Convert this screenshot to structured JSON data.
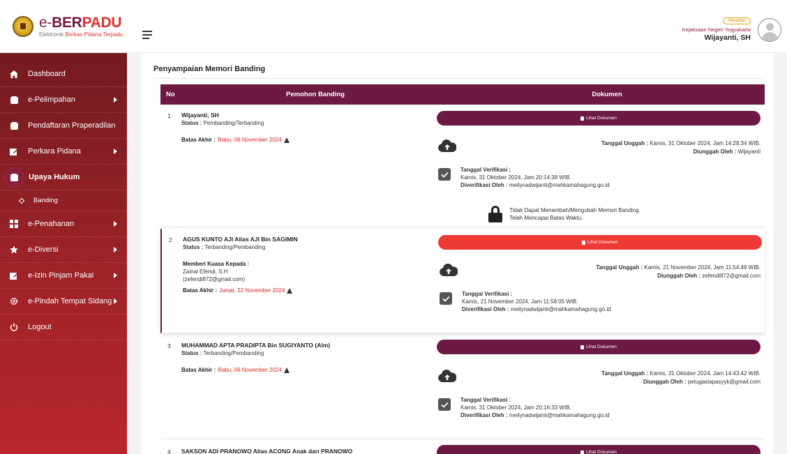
{
  "brand": {
    "title_part1": "e-",
    "title_part2": "BER",
    "title_part3": "PADU",
    "subtitle_a": "Elektronik",
    "subtitle_b": "Berkas Pidana Terpadu"
  },
  "sidebar": {
    "items": [
      {
        "label": "Dashboard",
        "icon": "home-icon"
      },
      {
        "label": "e-Pelimpahan",
        "icon": "folder-icon"
      },
      {
        "label": "Pendaftaran Praperadilan",
        "icon": "folder-icon"
      },
      {
        "label": "Perkara Pidana",
        "icon": "pencil-square-icon"
      },
      {
        "label": "Upaya Hukum",
        "icon": "folder-icon",
        "active": true
      },
      {
        "label": "e-Penahanan",
        "icon": "grid-icon"
      },
      {
        "label": "e-Diversi",
        "icon": "star-icon"
      },
      {
        "label": "e-Izin Pinjam Pakai",
        "icon": "pencil-square-icon"
      },
      {
        "label": "e-Pindah Tempat Sidang",
        "icon": "gear-icon"
      },
      {
        "label": "Logout",
        "icon": "power-icon"
      }
    ],
    "submenu": {
      "label": "Banding"
    }
  },
  "header": {
    "role": "Penuntut",
    "org": "Kejaksaan Negeri Yogyakarta",
    "user": "Wijayanti, SH"
  },
  "main": {
    "title": "Penyampaian Memori Banding",
    "columns": {
      "no": "No",
      "pemohon": "Pemohon Banding",
      "dokumen": "Dokumen"
    },
    "button_label": "Lihat Dokumen",
    "labels": {
      "status": "Status :",
      "batas": "Batas Akhir :",
      "kuasa": "Memberi Kuasa Kepada :",
      "tgl_unggah": "Tanggal Unggah :",
      "diunggah": "Diunggah Oleh :",
      "tgl_verif": "Tanggal Verifikasi :",
      "diverif": "Diverifikasi Oleh :"
    },
    "rows": [
      {
        "no": "1",
        "name": "Wijayanti, SH",
        "status": "Pembanding/Terbanding",
        "batas": "Rabu, 06 November 2024",
        "upload_date": "Kamis, 31 Oktober 2024, Jam 14:28:34 WIB.",
        "uploader": "Wijayanti",
        "verif_date": "Kamis, 31 Oktober 2024, Jam 20:14:38 WIB.",
        "verifier": "meilynadwijanti@mahkamahagung.go.id",
        "locked_line1": "Tidak Dapat Menambah/Mengubah Memori Banding.",
        "locked_line2": "Telah Mencapai Batas Waktu."
      },
      {
        "no": "2",
        "name": "AGUS KUNTO AJI Alias AJI Bin SAGIMIN",
        "status": "Terbanding/Pembanding",
        "kuasa_name": "Zainal Efendi, S.H",
        "kuasa_email": "(zefendi872@gmail.com)",
        "batas": "Jumat, 22 November 2024",
        "upload_date": "Kamis, 21 November 2024, Jam 11:54:49 WIB.",
        "uploader": "zefendi872@gmail.com",
        "verif_date": "Kamis, 21 November 2024, Jam 11:58:05 WIB.",
        "verifier": "meilynadwijanti@mahkamahagung.go.id"
      },
      {
        "no": "3",
        "name": "MUHAMMAD APTA PRADIPTA Bin SUGIYANTO (Alm)",
        "status": "Terbanding/Pembanding",
        "batas": "Rabu, 06 November 2024",
        "upload_date": "Kamis, 31 Oktober 2024, Jam 14:43:42 WIB.",
        "uploader": "petugaslapasyyk@gmail.com",
        "verif_date": "Kamis, 31 Oktober 2024, Jam 20:16:33 WIB.",
        "verifier": "meilynadwijanti@mahkamahagung.go.id"
      },
      {
        "no": "4",
        "name": "SAKSON ADI PRANOWO Alias ACONG Anak dari PRANOWO"
      }
    ]
  }
}
